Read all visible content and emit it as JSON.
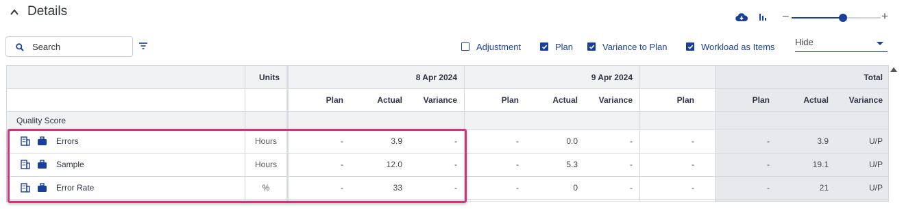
{
  "section": {
    "title": "Details"
  },
  "toolbar": {
    "zoom_minus": "–",
    "zoom_plus": "+",
    "zoom_fraction": 0.58
  },
  "search": {
    "placeholder": "Search",
    "value": ""
  },
  "options": {
    "adjustment": {
      "label": "Adjustment",
      "checked": false
    },
    "plan": {
      "label": "Plan",
      "checked": true
    },
    "variance_to_plan": {
      "label": "Variance to Plan",
      "checked": true
    },
    "workload_as_items": {
      "label": "Workload as Items",
      "checked": true
    }
  },
  "hide_select": {
    "value": "Hide"
  },
  "table": {
    "units_header": "Units",
    "dates": [
      "8 Apr 2024",
      "9 Apr 2024"
    ],
    "total_header": "Total",
    "sub_headers": {
      "plan": "Plan",
      "actual": "Actual",
      "variance": "Variance"
    },
    "group": "Quality Score",
    "rows": [
      {
        "name": "Errors",
        "units": "Hours",
        "d1": [
          "-",
          "3.9",
          "-"
        ],
        "d2": [
          "-",
          "0.0",
          "-"
        ],
        "d3_plan": "-",
        "total": [
          "-",
          "3.9",
          "U/P"
        ]
      },
      {
        "name": "Sample",
        "units": "Hours",
        "d1": [
          "-",
          "12.0",
          "-"
        ],
        "d2": [
          "-",
          "5.3",
          "-"
        ],
        "d3_plan": "-",
        "total": [
          "-",
          "19.1",
          "U/P"
        ]
      },
      {
        "name": "Error Rate",
        "units": "%",
        "d1": [
          "-",
          "33",
          "-"
        ],
        "d2": [
          "-",
          "0",
          "-"
        ],
        "d3_plan": "-",
        "total": [
          "-",
          "21",
          "U/P"
        ]
      }
    ]
  },
  "colors": {
    "accent": "#1a3f9a",
    "highlight": "#d1337a",
    "total_bg": "#e7e9ec",
    "header_bg": "#f1f2f4"
  }
}
